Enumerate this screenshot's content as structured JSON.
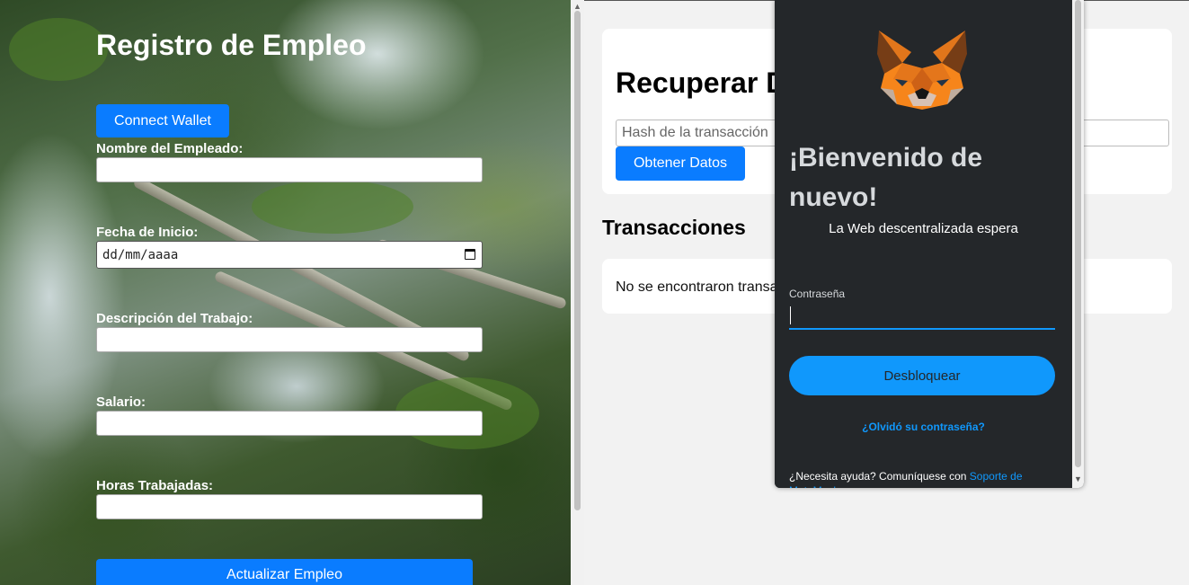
{
  "left": {
    "title": "Registro de Empleo",
    "connect_label": "Connect Wallet",
    "fields": {
      "name_label": "Nombre del Empleado:",
      "date_label": "Fecha de Inicio:",
      "date_placeholder": "dd/mm/aaaa",
      "desc_label": "Descripción del Trabajo:",
      "salary_label": "Salario:",
      "hours_label": "Horas Trabajadas:"
    },
    "update_label": "Actualizar Empleo"
  },
  "right": {
    "recover_title": "Recuperar D",
    "hash_placeholder": "Hash de la transacción",
    "get_label": "Obtener Datos",
    "tx_title": "Transacciones",
    "no_tx": "No se encontraron transa"
  },
  "metamask": {
    "welcome": "¡Bienvenido de nuevo!",
    "subtitle": "La Web descentralizada espera",
    "password_label": "Contraseña",
    "unlock_label": "Desbloquear",
    "forgot_label": "¿Olvidó su contraseña?",
    "help_text": "¿Necesita ayuda? Comuníquese con ",
    "help_link": "Soporte de MetaMask",
    "accent_color": "#1098fc",
    "background_color": "#24272a"
  },
  "icons": {
    "calendar": "calendar-icon",
    "fox": "metamask-fox-icon"
  }
}
